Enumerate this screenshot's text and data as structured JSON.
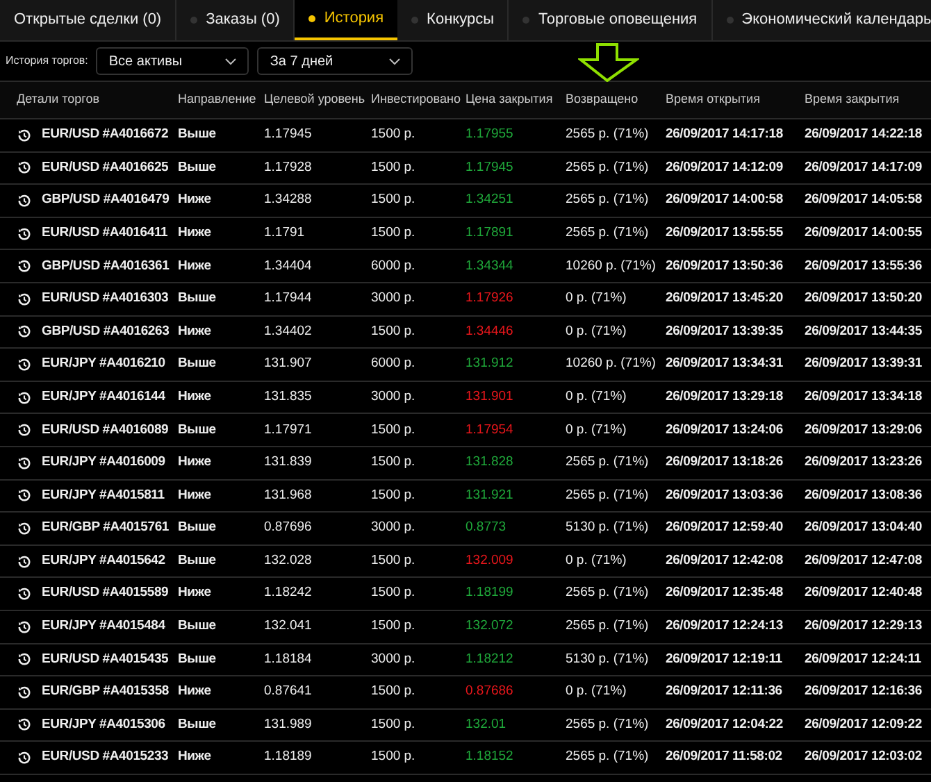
{
  "tabs": [
    {
      "label": "Открытые сделки (0)",
      "selected": false,
      "dot": false
    },
    {
      "label": "Заказы (0)",
      "selected": false,
      "dot": true
    },
    {
      "label": "История",
      "selected": true,
      "dot": true
    },
    {
      "label": "Конкурсы",
      "selected": false,
      "dot": true
    },
    {
      "label": "Торговые оповещения",
      "selected": false,
      "dot": true
    },
    {
      "label": "Экономический календарь",
      "selected": false,
      "dot": true
    }
  ],
  "filters": {
    "label": "История торгов:",
    "asset": "Все активы",
    "period": "За 7 дней"
  },
  "table": {
    "columns": [
      "Детали торгов",
      "Направление",
      "Целевой уровень",
      "Инвестировано",
      "Цена закрытия",
      "Возвращено",
      "Время открытия",
      "Время закрытия"
    ],
    "rows": [
      {
        "trade": "EUR/USD #A4016672",
        "direction": "Выше",
        "target": "1.17945",
        "invested": "1500 р.",
        "close_price": "1.17955",
        "color": "#1fa83a",
        "returned": "2565 р. (71%)",
        "opened": "26/09/2017 14:17:18",
        "closed": "26/09/2017 14:22:18"
      },
      {
        "trade": "EUR/USD #A4016625",
        "direction": "Выше",
        "target": "1.17928",
        "invested": "1500 р.",
        "close_price": "1.17945",
        "color": "#1fa83a",
        "returned": "2565 р. (71%)",
        "opened": "26/09/2017 14:12:09",
        "closed": "26/09/2017 14:17:09"
      },
      {
        "trade": "GBP/USD #A4016479",
        "direction": "Ниже",
        "target": "1.34288",
        "invested": "1500 р.",
        "close_price": "1.34251",
        "color": "#1fa83a",
        "returned": "2565 р. (71%)",
        "opened": "26/09/2017 14:00:58",
        "closed": "26/09/2017 14:05:58"
      },
      {
        "trade": "EUR/USD #A4016411",
        "direction": "Ниже",
        "target": "1.1791",
        "invested": "1500 р.",
        "close_price": "1.17891",
        "color": "#1fa83a",
        "returned": "2565 р. (71%)",
        "opened": "26/09/2017 13:55:55",
        "closed": "26/09/2017 14:00:55"
      },
      {
        "trade": "GBP/USD #A4016361",
        "direction": "Ниже",
        "target": "1.34404",
        "invested": "6000 р.",
        "close_price": "1.34344",
        "color": "#1fa83a",
        "returned": "10260 р. (71%)",
        "opened": "26/09/2017 13:50:36",
        "closed": "26/09/2017 13:55:36"
      },
      {
        "trade": "EUR/USD #A4016303",
        "direction": "Выше",
        "target": "1.17944",
        "invested": "3000 р.",
        "close_price": "1.17926",
        "color": "#e8161b",
        "returned": "0 р. (71%)",
        "opened": "26/09/2017 13:45:20",
        "closed": "26/09/2017 13:50:20"
      },
      {
        "trade": "GBP/USD #A4016263",
        "direction": "Ниже",
        "target": "1.34402",
        "invested": "1500 р.",
        "close_price": "1.34446",
        "color": "#e8161b",
        "returned": "0 р. (71%)",
        "opened": "26/09/2017 13:39:35",
        "closed": "26/09/2017 13:44:35"
      },
      {
        "trade": "EUR/JPY #A4016210",
        "direction": "Выше",
        "target": "131.907",
        "invested": "6000 р.",
        "close_price": "131.912",
        "color": "#1fa83a",
        "returned": "10260 р. (71%)",
        "opened": "26/09/2017 13:34:31",
        "closed": "26/09/2017 13:39:31"
      },
      {
        "trade": "EUR/JPY #A4016144",
        "direction": "Ниже",
        "target": "131.835",
        "invested": "3000 р.",
        "close_price": "131.901",
        "color": "#e8161b",
        "returned": "0 р. (71%)",
        "opened": "26/09/2017 13:29:18",
        "closed": "26/09/2017 13:34:18"
      },
      {
        "trade": "EUR/USD #A4016089",
        "direction": "Выше",
        "target": "1.17971",
        "invested": "1500 р.",
        "close_price": "1.17954",
        "color": "#e8161b",
        "returned": "0 р. (71%)",
        "opened": "26/09/2017 13:24:06",
        "closed": "26/09/2017 13:29:06"
      },
      {
        "trade": "EUR/JPY #A4016009",
        "direction": "Ниже",
        "target": "131.839",
        "invested": "1500 р.",
        "close_price": "131.828",
        "color": "#1fa83a",
        "returned": "2565 р. (71%)",
        "opened": "26/09/2017 13:18:26",
        "closed": "26/09/2017 13:23:26"
      },
      {
        "trade": "EUR/JPY #A4015811",
        "direction": "Ниже",
        "target": "131.968",
        "invested": "1500 р.",
        "close_price": "131.921",
        "color": "#1fa83a",
        "returned": "2565 р. (71%)",
        "opened": "26/09/2017 13:03:36",
        "closed": "26/09/2017 13:08:36"
      },
      {
        "trade": "EUR/GBP #A4015761",
        "direction": "Выше",
        "target": "0.87696",
        "invested": "3000 р.",
        "close_price": "0.8773",
        "color": "#1fa83a",
        "returned": "5130 р. (71%)",
        "opened": "26/09/2017 12:59:40",
        "closed": "26/09/2017 13:04:40"
      },
      {
        "trade": "EUR/JPY #A4015642",
        "direction": "Выше",
        "target": "132.028",
        "invested": "1500 р.",
        "close_price": "132.009",
        "color": "#e8161b",
        "returned": "0 р. (71%)",
        "opened": "26/09/2017 12:42:08",
        "closed": "26/09/2017 12:47:08"
      },
      {
        "trade": "EUR/USD #A4015589",
        "direction": "Ниже",
        "target": "1.18242",
        "invested": "1500 р.",
        "close_price": "1.18199",
        "color": "#1fa83a",
        "returned": "2565 р. (71%)",
        "opened": "26/09/2017 12:35:48",
        "closed": "26/09/2017 12:40:48"
      },
      {
        "trade": "EUR/JPY #A4015484",
        "direction": "Выше",
        "target": "132.041",
        "invested": "1500 р.",
        "close_price": "132.072",
        "color": "#1fa83a",
        "returned": "2565 р. (71%)",
        "opened": "26/09/2017 12:24:13",
        "closed": "26/09/2017 12:29:13"
      },
      {
        "trade": "EUR/USD #A4015435",
        "direction": "Выше",
        "target": "1.18184",
        "invested": "3000 р.",
        "close_price": "1.18212",
        "color": "#1fa83a",
        "returned": "5130 р. (71%)",
        "opened": "26/09/2017 12:19:11",
        "closed": "26/09/2017 12:24:11"
      },
      {
        "trade": "EUR/GBP #A4015358",
        "direction": "Ниже",
        "target": "0.87641",
        "invested": "1500 р.",
        "close_price": "0.87686",
        "color": "#e8161b",
        "returned": "0 р. (71%)",
        "opened": "26/09/2017 12:11:36",
        "closed": "26/09/2017 12:16:36"
      },
      {
        "trade": "EUR/JPY #A4015306",
        "direction": "Выше",
        "target": "131.989",
        "invested": "1500 р.",
        "close_price": "132.01",
        "color": "#1fa83a",
        "returned": "2565 р. (71%)",
        "opened": "26/09/2017 12:04:22",
        "closed": "26/09/2017 12:09:22"
      },
      {
        "trade": "EUR/USD #A4015233",
        "direction": "Ниже",
        "target": "1.18189",
        "invested": "1500 р.",
        "close_price": "1.18152",
        "color": "#1fa83a",
        "returned": "2565 р. (71%)",
        "opened": "26/09/2017 11:58:02",
        "closed": "26/09/2017 12:03:02"
      }
    ]
  }
}
